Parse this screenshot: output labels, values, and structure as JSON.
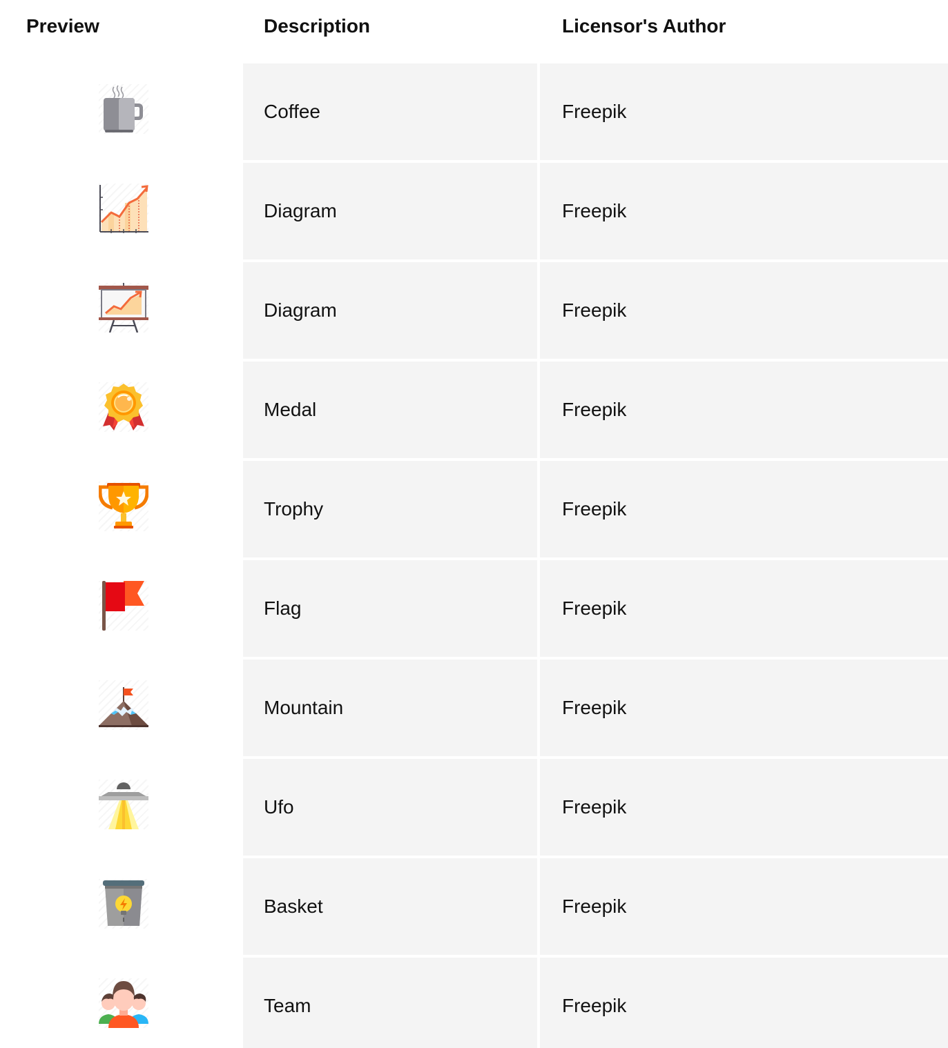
{
  "header": {
    "preview": "Preview",
    "description": "Description",
    "author": "Licensor's Author"
  },
  "rows": [
    {
      "icon": "coffee-mug-icon",
      "description": "Coffee",
      "author": "Freepik"
    },
    {
      "icon": "line-chart-icon",
      "description": "Diagram",
      "author": "Freepik"
    },
    {
      "icon": "presentation-board-icon",
      "description": "Diagram",
      "author": "Freepik"
    },
    {
      "icon": "medal-icon",
      "description": "Medal",
      "author": "Freepik"
    },
    {
      "icon": "trophy-icon",
      "description": "Trophy",
      "author": "Freepik"
    },
    {
      "icon": "flag-icon",
      "description": "Flag",
      "author": "Freepik"
    },
    {
      "icon": "mountain-icon",
      "description": "Mountain",
      "author": "Freepik"
    },
    {
      "icon": "ufo-icon",
      "description": "Ufo",
      "author": "Freepik"
    },
    {
      "icon": "basket-icon",
      "description": "Basket",
      "author": "Freepik"
    },
    {
      "icon": "team-icon",
      "description": "Team",
      "author": "Freepik"
    }
  ]
}
